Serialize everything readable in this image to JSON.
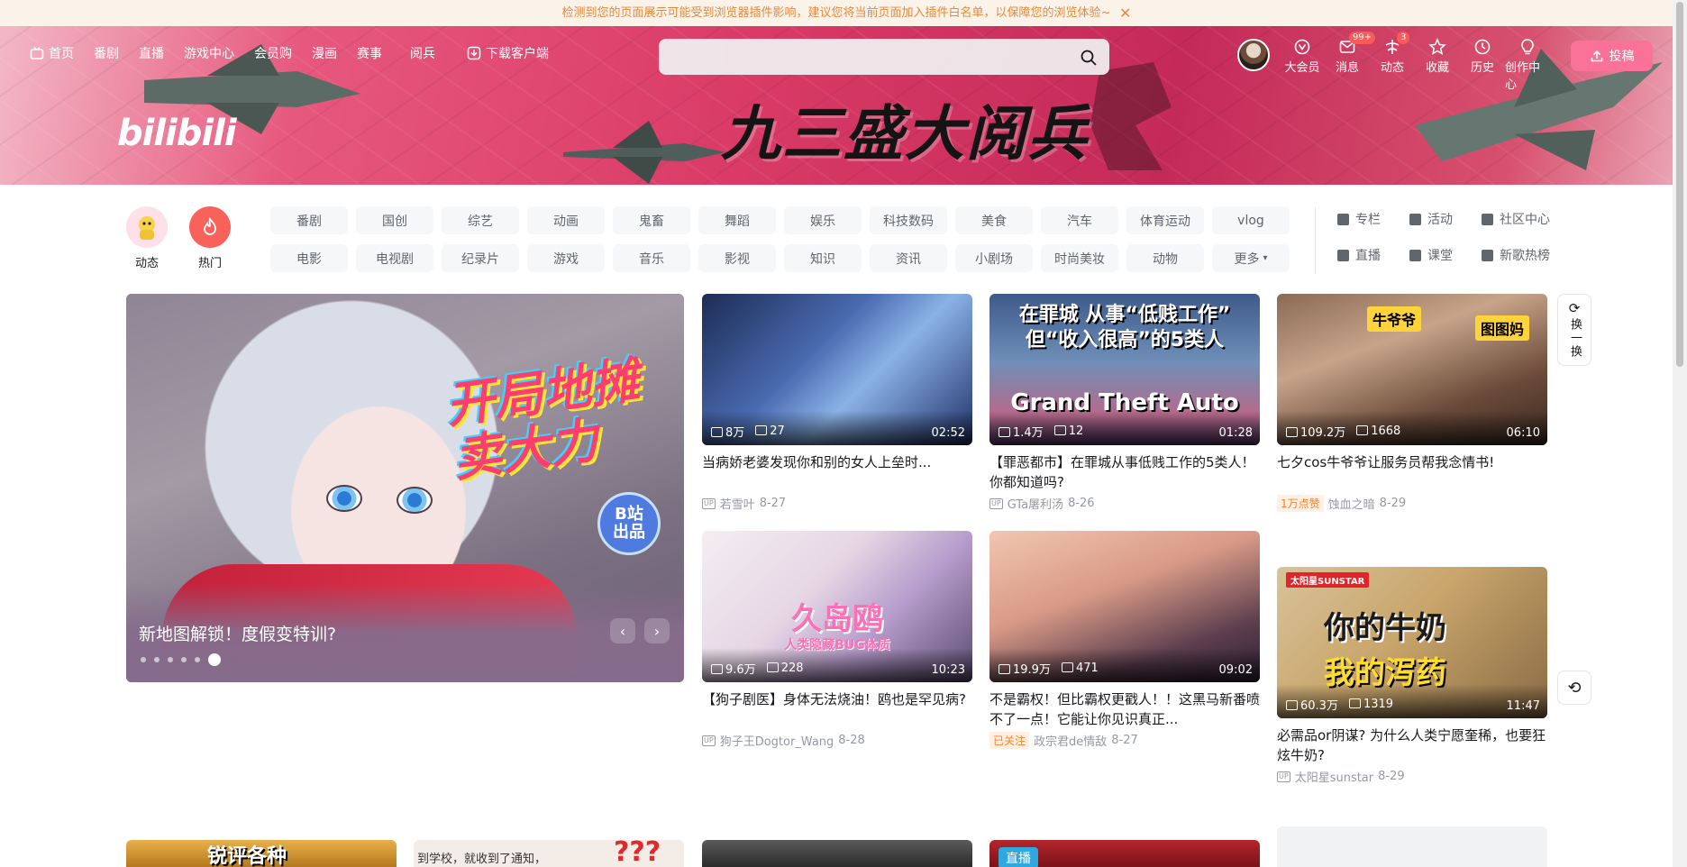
{
  "notice": {
    "text": "检测到您的页面展示可能受到浏览器插件影响，建议您将当前页面加入插件白名单，以保障您的浏览体验~",
    "close": "✕"
  },
  "header": {
    "nav": [
      "首页",
      "番剧",
      "直播",
      "游戏中心",
      "会员购",
      "漫画",
      "赛事",
      "阅兵",
      "下载客户端"
    ],
    "search_placeholder": "",
    "banner_title": "九三盛大阅兵",
    "logo": "bilibili",
    "right_nav": [
      {
        "label": "大会员",
        "icon": "vip-icon",
        "badge": ""
      },
      {
        "label": "消息",
        "icon": "message-icon",
        "badge": "99+"
      },
      {
        "label": "动态",
        "icon": "dynamic-icon",
        "badge": "3"
      },
      {
        "label": "收藏",
        "icon": "star-icon",
        "badge": ""
      },
      {
        "label": "历史",
        "icon": "clock-icon",
        "badge": ""
      },
      {
        "label": "创作中心",
        "icon": "bulb-icon",
        "badge": ""
      }
    ],
    "upload": "投稿"
  },
  "quick": {
    "dynamic": "动态",
    "hot": "热门"
  },
  "channels": [
    "番剧",
    "国创",
    "综艺",
    "动画",
    "鬼畜",
    "舞蹈",
    "娱乐",
    "科技数码",
    "美食",
    "汽车",
    "体育运动",
    "vlog",
    "电影",
    "电视剧",
    "纪录片",
    "游戏",
    "音乐",
    "影视",
    "知识",
    "资讯",
    "小剧场",
    "时尚美妆",
    "动物",
    "更多"
  ],
  "side_links": [
    "专栏",
    "活动",
    "社区中心",
    "直播",
    "课堂",
    "新歌热榜"
  ],
  "carousel": {
    "caption": "新地图解锁！度假变特训?",
    "art_text": "开局地摊\n卖大力",
    "badge": "B站\n出品",
    "dots": 6,
    "active_dot": 5,
    "prev": "‹",
    "next": "›"
  },
  "videos": [
    {
      "views": "8万",
      "danmaku": "27",
      "duration": "02:52",
      "title": "当病娇老婆发现你和别的女人上垒时...",
      "author": "若雪叶",
      "date": "8-27",
      "tag": "",
      "thumb_text": ""
    },
    {
      "views": "1.4万",
      "danmaku": "12",
      "duration": "01:28",
      "title": "【罪恶都市】在罪城从事低贱工作的5类人！你都知道吗?",
      "author": "GTa屠利汤",
      "date": "8-26",
      "tag": "",
      "thumb_text": "在罪城 从事“低贱工作”\n但“收入很高”的5类人",
      "thumb_text2": "Grand Theft Auto"
    },
    {
      "views": "109.2万",
      "danmaku": "1668",
      "duration": "06:10",
      "title": "七夕cos牛爷爷让服务员帮我念情书!",
      "author": "蚀血之暗",
      "date": "8-29",
      "tag": "1万点赞",
      "thumb_text": "牛爷爷",
      "thumb_text2": "图图妈"
    },
    {
      "views": "9.6万",
      "danmaku": "228",
      "duration": "10:23",
      "title": "【狗子剧医】身体无法烧油！鸥也是罕见病?",
      "author": "狗子王Dogtor_Wang",
      "date": "8-28",
      "tag": "",
      "thumb_text": "久岛鸥",
      "thumb_text2": "人类隐藏BUG体质"
    },
    {
      "views": "19.9万",
      "danmaku": "471",
      "duration": "09:02",
      "title": "不是霸权！但比霸权更戳人！！这黑马新番喷不了一点！它能让你见识真正...",
      "author": "政宗君de情敌",
      "date": "8-27",
      "tag": "已关注",
      "thumb_text": ""
    },
    {
      "views": "60.3万",
      "danmaku": "1319",
      "duration": "11:47",
      "title": "必需品or阴谋? 为什么人类宁愿奎稀，也要狂炫牛奶?",
      "author": "太阳星sunstar",
      "date": "8-29",
      "tag": "",
      "thumb_text": "你的牛奶",
      "thumb_text2": "我的泻药"
    }
  ],
  "refresh": "换一换",
  "bottom_row": [
    "锐评各种",
    "到学校，就收到了通知，",
    "",
    "直播",
    ""
  ]
}
